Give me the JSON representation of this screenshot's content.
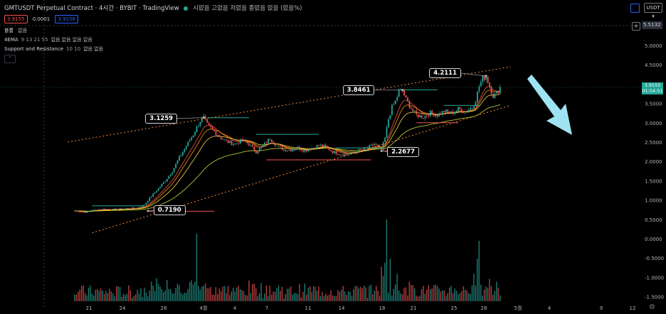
{
  "header": {
    "title": "GMTUSDT Perpetual Contract · 4시간 · BYBIT · TradingView",
    "ohlc_text": "시없음 고없음 저없음 종없음 없음 (없음%)",
    "sell_price": "3.9155",
    "spread": "0.0001",
    "buy_price": "3.9156",
    "currency": "USDT",
    "top_value": "5.5132"
  },
  "indicators": [
    {
      "name": "볼륨",
      "params": "",
      "values": "없음"
    },
    {
      "name": "4EMA",
      "params": "9 13 21 55",
      "values": "없음 없음 없음 없음"
    },
    {
      "name": "Support and Resistance",
      "params": "10 10",
      "values": "없음 없음"
    }
  ],
  "last_price": {
    "value": "3.9155",
    "countdown": "01:54:51"
  },
  "collapse_icon": "chevron-up-icon",
  "settings_icon": "gear-icon",
  "colors": {
    "up": "#26a69a",
    "down": "#ef5350",
    "channel": "#f0883e",
    "arrow": "#9fe3f2",
    "sr_support": "#ef5350",
    "sr_resistance": "#26a69a"
  },
  "chart_data": {
    "type": "candlestick",
    "y_ticks": [
      "5.0000",
      "4.5000",
      "4.0000",
      "3.5000",
      "3.0000",
      "2.5000",
      "2.0000",
      "1.5000",
      "1.0000",
      "0.5000",
      "0.0000",
      "-0.5000",
      "-1.0000",
      "-1.5000"
    ],
    "x_ticks": [
      "21",
      "24",
      "28",
      "4월",
      "4",
      "7",
      "11",
      "14",
      "18",
      "21",
      "25",
      "28",
      "5월",
      "4",
      "9",
      "12"
    ],
    "ylim": [
      -1.9,
      5.8
    ],
    "price_path": [
      [
        0,
        0.72
      ],
      [
        6,
        0.68
      ],
      [
        10,
        0.74
      ],
      [
        16,
        0.77
      ],
      [
        22,
        0.76
      ],
      [
        30,
        0.78
      ],
      [
        36,
        0.8
      ],
      [
        40,
        0.88
      ],
      [
        44,
        1.1
      ],
      [
        48,
        1.3
      ],
      [
        52,
        1.5
      ],
      [
        56,
        1.75
      ],
      [
        60,
        2.1
      ],
      [
        64,
        2.4
      ],
      [
        68,
        2.7
      ],
      [
        72,
        3.05
      ],
      [
        74,
        3.13
      ],
      [
        76,
        2.95
      ],
      [
        80,
        2.78
      ],
      [
        84,
        2.6
      ],
      [
        88,
        2.5
      ],
      [
        92,
        2.45
      ],
      [
        96,
        2.55
      ],
      [
        100,
        2.45
      ],
      [
        104,
        2.25
      ],
      [
        108,
        2.4
      ],
      [
        112,
        2.6
      ],
      [
        116,
        2.4
      ],
      [
        120,
        2.3
      ],
      [
        124,
        2.3
      ],
      [
        128,
        2.35
      ],
      [
        132,
        2.28
      ],
      [
        136,
        2.35
      ],
      [
        140,
        2.42
      ],
      [
        144,
        2.38
      ],
      [
        148,
        2.25
      ],
      [
        152,
        2.2
      ],
      [
        156,
        2.18
      ],
      [
        160,
        2.22
      ],
      [
        164,
        2.3
      ],
      [
        168,
        2.35
      ],
      [
        172,
        2.45
      ],
      [
        176,
        2.3
      ],
      [
        178,
        2.6
      ],
      [
        180,
        3.1
      ],
      [
        182,
        3.4
      ],
      [
        184,
        3.55
      ],
      [
        186,
        3.82
      ],
      [
        188,
        3.84
      ],
      [
        190,
        3.6
      ],
      [
        192,
        3.45
      ],
      [
        194,
        3.3
      ],
      [
        196,
        3.2
      ],
      [
        200,
        3.15
      ],
      [
        204,
        3.25
      ],
      [
        208,
        3.2
      ],
      [
        212,
        3.3
      ],
      [
        216,
        3.25
      ],
      [
        220,
        3.35
      ],
      [
        224,
        3.3
      ],
      [
        228,
        3.4
      ],
      [
        230,
        3.6
      ],
      [
        232,
        3.95
      ],
      [
        234,
        4.15
      ],
      [
        236,
        4.21
      ],
      [
        238,
        3.95
      ],
      [
        240,
        3.7
      ],
      [
        242,
        3.75
      ],
      [
        244,
        3.92
      ]
    ],
    "ema_lines": [
      {
        "name": "EMA 9",
        "color": "#ef5350"
      },
      {
        "name": "EMA 13",
        "color": "#ff9800"
      },
      {
        "name": "EMA 21",
        "color": "#ffd54f"
      },
      {
        "name": "EMA 55",
        "color": "#cddc39"
      }
    ],
    "volume_scale": 1.0,
    "annotations": [
      {
        "text": "3.1259",
        "x": 74,
        "y": 3.13
      },
      {
        "text": "0.7190",
        "x": 42,
        "y": 0.72
      },
      {
        "text": "3.8461",
        "x": 188,
        "y": 3.846
      },
      {
        "text": "2.2677",
        "x": 176,
        "y": 2.27
      },
      {
        "text": "4.2111",
        "x": 236,
        "y": 4.211
      }
    ],
    "channel": {
      "upper": [
        [
          -4,
          2.5
        ],
        [
          250,
          4.45
        ]
      ],
      "lower": [
        [
          10,
          0.15
        ],
        [
          250,
          3.45
        ]
      ]
    },
    "resistance_levels": [
      {
        "x0": 76,
        "x1": 100,
        "y": 3.13
      },
      {
        "x0": 104,
        "x1": 140,
        "y": 2.7
      },
      {
        "x0": 188,
        "x1": 208,
        "y": 3.85
      },
      {
        "x0": 150,
        "x1": 176,
        "y": 2.35
      },
      {
        "x0": 212,
        "x1": 232,
        "y": 3.45
      },
      {
        "x0": 10,
        "x1": 40,
        "y": 0.85
      }
    ],
    "support_levels": [
      {
        "x0": 42,
        "x1": 80,
        "y": 0.71
      },
      {
        "x0": 110,
        "x1": 170,
        "y": 2.04
      },
      {
        "x0": 176,
        "x1": 196,
        "y": 2.27
      },
      {
        "x0": 196,
        "x1": 220,
        "y": 3.0
      }
    ]
  }
}
